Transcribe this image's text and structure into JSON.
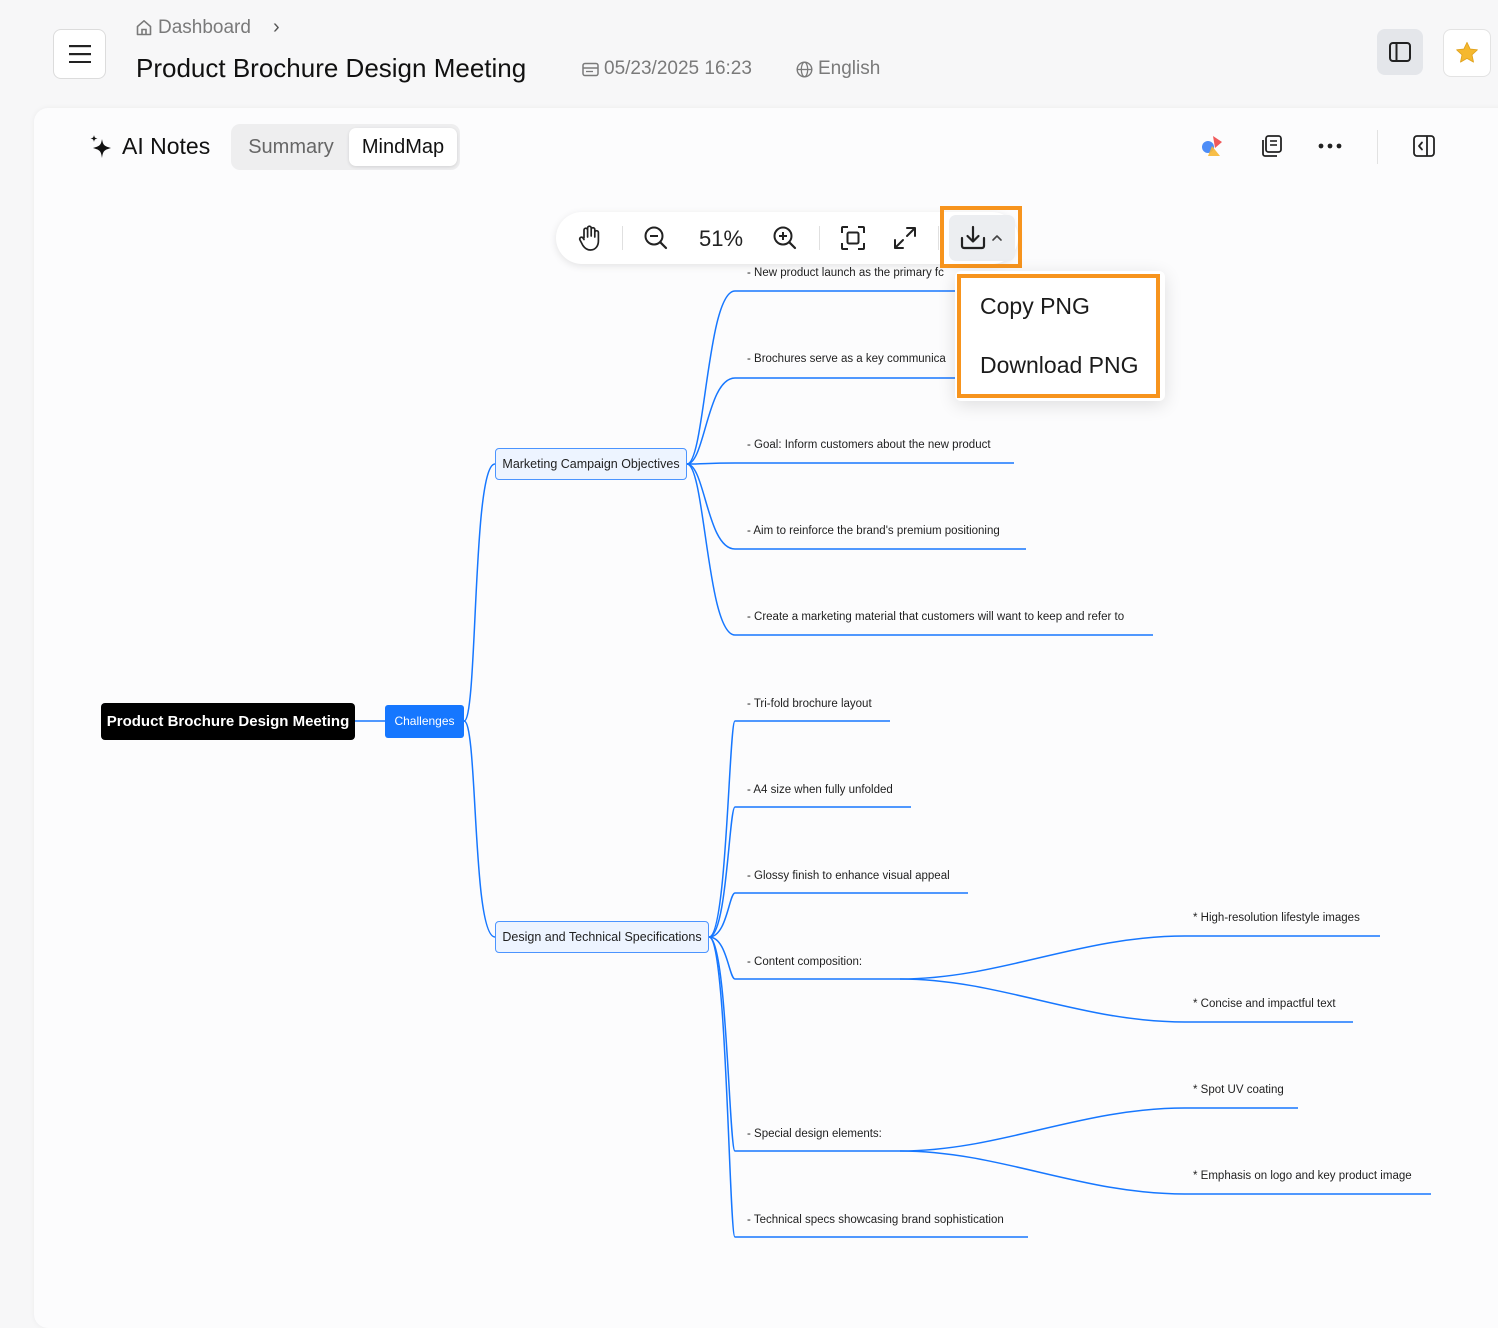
{
  "header": {
    "breadcrumb": "Dashboard",
    "title": "Product Brochure Design Meeting",
    "datetime": "05/23/2025 16:23",
    "language": "English"
  },
  "panel": {
    "heading": "AI Notes",
    "tabs": [
      {
        "label": "Summary",
        "active": false
      },
      {
        "label": "MindMap",
        "active": true
      }
    ]
  },
  "toolbar": {
    "zoom_level": "51%",
    "icons": [
      "hand-icon",
      "zoom-out-icon",
      "zoom-in-icon",
      "fit-screen-icon",
      "fullscreen-icon",
      "download-icon"
    ]
  },
  "download_menu": {
    "items": [
      "Copy PNG",
      "Download PNG"
    ]
  },
  "mindmap": {
    "root": "Product Brochure Design Meeting",
    "level1": "Challenges",
    "branches": [
      {
        "label": "Marketing Campaign Objectives",
        "items": [
          "- New product launch as the primary fc",
          "- Brochures serve as a key communica",
          "- Goal: Inform customers about the new product",
          "- Aim to reinforce the brand's premium positioning",
          "- Create a marketing material that customers will want to keep and refer to"
        ]
      },
      {
        "label": "Design and Technical Specifications",
        "items": [
          "- Tri-fold brochure layout",
          "- A4 size when fully unfolded",
          "- Glossy finish to enhance visual appeal",
          "- Content composition:",
          "- Special design elements:",
          "- Technical specs showcasing brand sophistication"
        ],
        "sub_items": {
          "content": [
            "* High-resolution lifestyle images",
            "* Concise and impactful text"
          ],
          "special": [
            "* Spot UV coating",
            "* Emphasis on logo and key product image"
          ]
        }
      }
    ]
  },
  "colors": {
    "accent": "#1677ff",
    "highlight": "#f7941d",
    "star": "#f5b82e"
  }
}
